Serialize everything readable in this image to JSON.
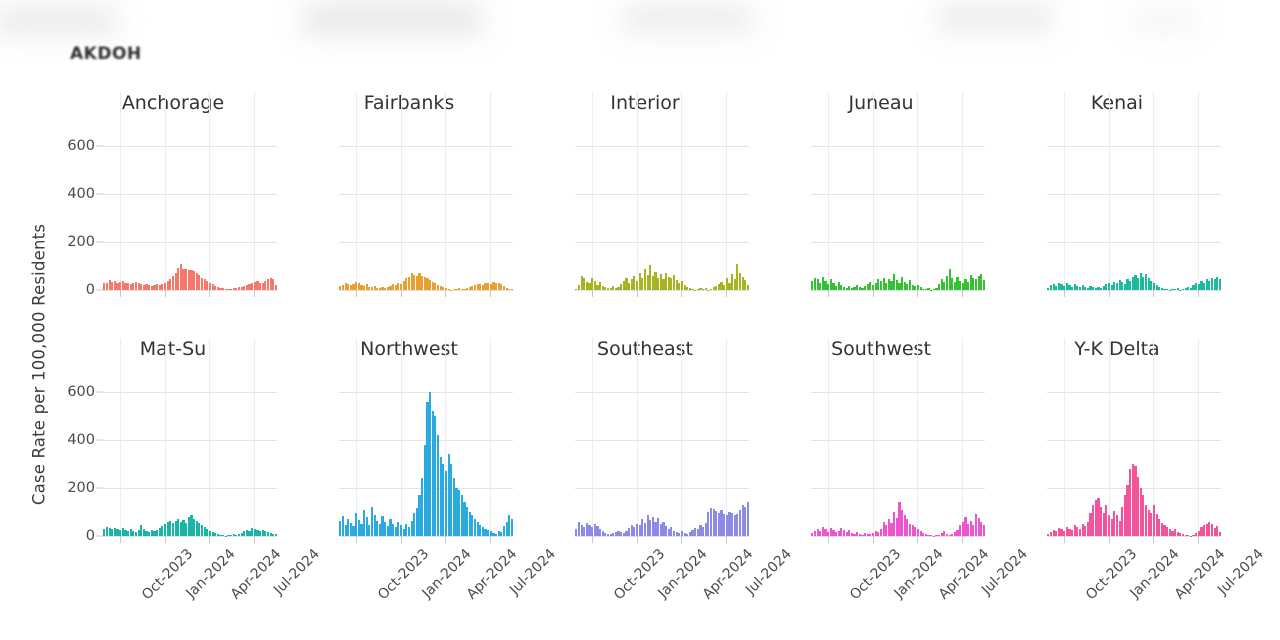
{
  "watermark": {
    "text": "AKDOH"
  },
  "axis": {
    "y_title": "Case Rate per 100,000 Residents",
    "y_ticks": [
      "0",
      "200",
      "400",
      "600"
    ],
    "x_ticks": [
      "Oct-2023",
      "Jan-2024",
      "Apr-2024",
      "Jul-2024"
    ]
  },
  "chart_data": {
    "type": "bar",
    "title": "",
    "subtitle": "",
    "xlabel": "",
    "ylabel": "Case Rate per 100,000 Residents",
    "ylim": [
      0,
      700
    ],
    "ytick_values": [
      0,
      200,
      400,
      600
    ],
    "xtick_labels": [
      "Oct-2023",
      "Jan-2024",
      "Apr-2024",
      "Jul-2024"
    ],
    "xtick_positions_frac": [
      0.1,
      0.355,
      0.61,
      0.865
    ],
    "grid": "both",
    "legend": "none",
    "layout": {
      "rows": 2,
      "cols": 5,
      "facet_order": [
        "Anchorage",
        "Fairbanks",
        "Interior",
        "Juneau",
        "Kenai",
        "Mat-Su",
        "Northwest",
        "Southeast",
        "Southwest",
        "Y-K Delta"
      ]
    },
    "panels": [
      {
        "name": "Anchorage",
        "color": "#f4786c",
        "values": [
          28,
          30,
          42,
          35,
          38,
          30,
          32,
          36,
          30,
          28,
          26,
          30,
          34,
          28,
          24,
          22,
          26,
          20,
          18,
          22,
          26,
          20,
          24,
          30,
          36,
          44,
          58,
          72,
          92,
          108,
          88,
          86,
          84,
          82,
          78,
          70,
          64,
          52,
          46,
          38,
          30,
          24,
          18,
          14,
          10,
          8,
          6,
          4,
          6,
          8,
          10,
          12,
          14,
          18,
          22,
          26,
          30,
          34,
          36,
          30,
          28,
          38,
          44,
          50,
          44,
          20
        ]
      },
      {
        "name": "Fairbanks",
        "color": "#e8a130",
        "values": [
          18,
          22,
          30,
          24,
          20,
          26,
          34,
          28,
          22,
          18,
          24,
          14,
          12,
          16,
          10,
          8,
          12,
          10,
          14,
          18,
          24,
          22,
          30,
          26,
          38,
          48,
          56,
          70,
          62,
          58,
          72,
          60,
          54,
          48,
          40,
          34,
          28,
          22,
          16,
          12,
          8,
          4,
          2,
          4,
          6,
          8,
          6,
          4,
          10,
          14,
          18,
          20,
          24,
          26,
          22,
          28,
          30,
          26,
          32,
          28,
          30,
          24,
          16,
          10,
          6,
          4
        ]
      },
      {
        "name": "Interior",
        "color": "#a7b321",
        "values": [
          6,
          22,
          60,
          48,
          34,
          28,
          50,
          38,
          22,
          34,
          18,
          12,
          10,
          8,
          16,
          10,
          14,
          26,
          38,
          52,
          30,
          44,
          60,
          36,
          70,
          52,
          86,
          62,
          104,
          58,
          74,
          50,
          66,
          44,
          72,
          56,
          48,
          64,
          40,
          30,
          36,
          22,
          14,
          8,
          4,
          2,
          6,
          10,
          4,
          8,
          2,
          6,
          12,
          18,
          26,
          34,
          22,
          48,
          30,
          66,
          44,
          108,
          70,
          54,
          40,
          22
        ]
      },
      {
        "name": "Juneau",
        "color": "#34c133",
        "values": [
          36,
          52,
          44,
          30,
          56,
          38,
          24,
          46,
          28,
          18,
          32,
          22,
          14,
          10,
          16,
          8,
          12,
          20,
          14,
          10,
          18,
          26,
          34,
          22,
          28,
          44,
          36,
          52,
          30,
          46,
          38,
          68,
          42,
          30,
          54,
          34,
          26,
          40,
          22,
          16,
          20,
          12,
          6,
          4,
          8,
          2,
          6,
          10,
          24,
          44,
          32,
          58,
          88,
          48,
          34,
          56,
          38,
          28,
          46,
          34,
          62,
          50,
          44,
          58,
          66,
          40
        ]
      },
      {
        "name": "Kenai",
        "color": "#1cbb9e",
        "values": [
          8,
          20,
          26,
          18,
          30,
          24,
          16,
          28,
          22,
          14,
          26,
          18,
          12,
          20,
          14,
          10,
          16,
          12,
          8,
          14,
          10,
          18,
          24,
          30,
          22,
          34,
          28,
          40,
          32,
          26,
          44,
          38,
          56,
          62,
          48,
          72,
          54,
          66,
          50,
          36,
          28,
          20,
          14,
          10,
          6,
          4,
          2,
          6,
          4,
          8,
          2,
          6,
          10,
          14,
          8,
          20,
          30,
          24,
          38,
          30,
          44,
          38,
          52,
          46,
          56,
          44
        ]
      },
      {
        "name": "Mat-Su",
        "color": "#1ab5a4",
        "values": [
          30,
          36,
          32,
          28,
          34,
          30,
          26,
          32,
          24,
          22,
          28,
          20,
          18,
          26,
          44,
          30,
          22,
          18,
          24,
          20,
          26,
          34,
          42,
          50,
          58,
          64,
          56,
          62,
          70,
          58,
          66,
          54,
          78,
          86,
          70,
          62,
          54,
          46,
          38,
          30,
          22,
          16,
          12,
          8,
          6,
          4,
          2,
          4,
          6,
          8,
          4,
          10,
          14,
          20,
          26,
          22,
          34,
          28,
          24,
          20,
          26,
          22,
          18,
          14,
          10,
          8
        ]
      },
      {
        "name": "Northwest",
        "color": "#29abe2",
        "values": [
          62,
          84,
          46,
          72,
          54,
          40,
          96,
          68,
          52,
          110,
          78,
          46,
          122,
          88,
          64,
          50,
          84,
          58,
          40,
          70,
          52,
          36,
          58,
          44,
          30,
          52,
          38,
          62,
          96,
          118,
          170,
          240,
          380,
          560,
          600,
          520,
          500,
          420,
          330,
          300,
          270,
          340,
          300,
          240,
          200,
          190,
          170,
          140,
          120,
          100,
          86,
          70,
          58,
          46,
          38,
          30,
          24,
          20,
          14,
          8,
          20,
          16,
          40,
          60,
          86,
          70
        ]
      },
      {
        "name": "Southeast",
        "color": "#8b8ae6",
        "values": [
          30,
          60,
          46,
          38,
          54,
          44,
          36,
          52,
          40,
          30,
          20,
          14,
          10,
          8,
          14,
          18,
          22,
          16,
          12,
          20,
          34,
          46,
          38,
          52,
          44,
          70,
          56,
          86,
          66,
          78,
          58,
          74,
          48,
          60,
          42,
          30,
          36,
          22,
          16,
          12,
          20,
          14,
          10,
          18,
          26,
          34,
          28,
          46,
          38,
          56,
          100,
          118,
          112,
          104,
          96,
          108,
          92,
          88,
          100,
          94,
          86,
          92,
          110,
          128,
          120,
          140
        ]
      },
      {
        "name": "Southwest",
        "color": "#ee55cc",
        "values": [
          14,
          20,
          30,
          22,
          36,
          28,
          18,
          32,
          24,
          16,
          22,
          34,
          26,
          18,
          24,
          14,
          10,
          16,
          8,
          6,
          12,
          10,
          8,
          14,
          20,
          18,
          30,
          58,
          44,
          72,
          56,
          98,
          76,
          140,
          110,
          86,
          70,
          52,
          44,
          36,
          28,
          20,
          14,
          10,
          6,
          4,
          2,
          6,
          4,
          14,
          22,
          8,
          4,
          10,
          18,
          26,
          44,
          58,
          80,
          50,
          62,
          46,
          90,
          74,
          60,
          46
        ]
      },
      {
        "name": "Y-K Delta",
        "color": "#f5529c",
        "values": [
          10,
          18,
          26,
          20,
          34,
          28,
          22,
          38,
          30,
          24,
          44,
          36,
          28,
          50,
          42,
          60,
          96,
          130,
          150,
          160,
          120,
          96,
          128,
          86,
          70,
          104,
          88,
          62,
          120,
          170,
          212,
          280,
          300,
          290,
          244,
          200,
          170,
          130,
          110,
          96,
          130,
          90,
          70,
          56,
          44,
          36,
          28,
          22,
          30,
          18,
          12,
          8,
          4,
          6,
          2,
          4,
          12,
          22,
          36,
          44,
          52,
          58,
          48,
          34,
          40,
          18
        ]
      }
    ]
  }
}
